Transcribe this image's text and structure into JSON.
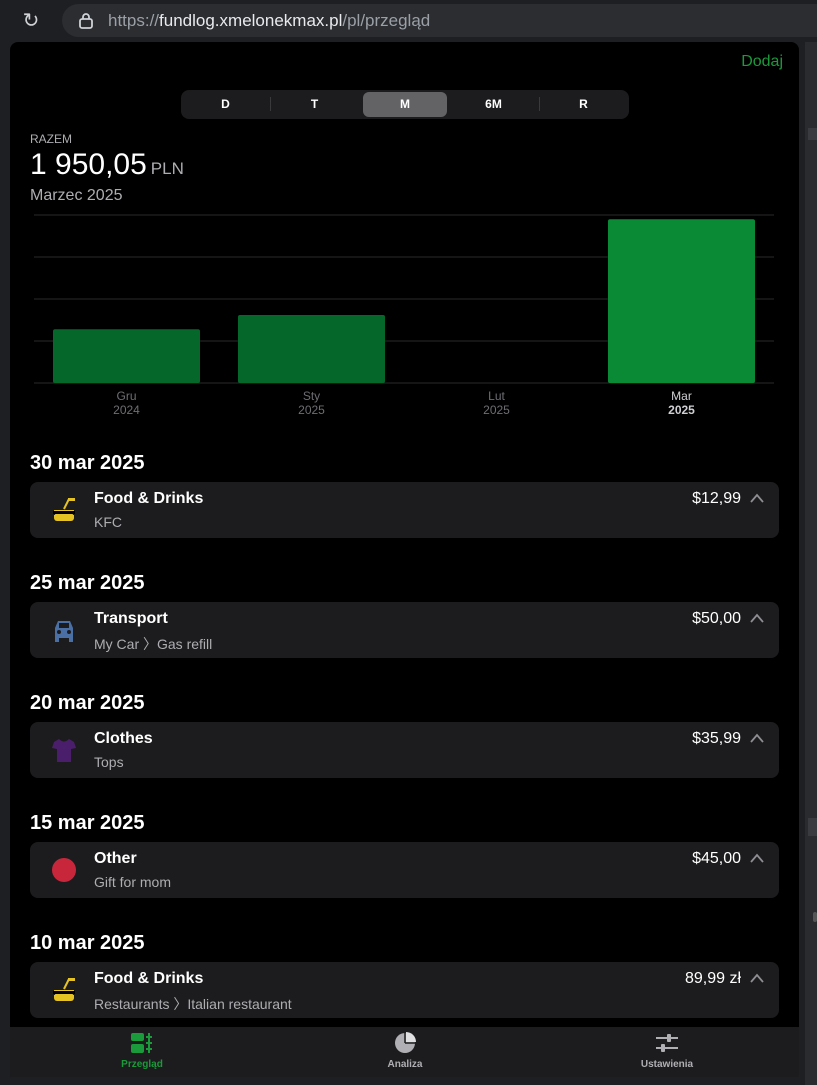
{
  "browser": {
    "url_prefix": "https://",
    "url_host": "fundlog.xmelonekmax.pl",
    "url_path": "/pl/przegląd"
  },
  "header": {
    "add_label": "Dodaj"
  },
  "segments": [
    {
      "label": "D"
    },
    {
      "label": "T"
    },
    {
      "label": "M",
      "active": true
    },
    {
      "label": "6M"
    },
    {
      "label": "R"
    }
  ],
  "summary": {
    "label": "RAZEM",
    "value": "1 950,05",
    "currency": "PLN",
    "period": "Marzec 2025"
  },
  "chart_data": {
    "type": "bar",
    "categories": [
      "Gru 2024",
      "Sty 2025",
      "Lut 2025",
      "Mar 2025"
    ],
    "tick_month": [
      "Gru",
      "Sty",
      "Lut",
      "Mar"
    ],
    "tick_year": [
      "2024",
      "2025",
      "2025",
      "2025"
    ],
    "values": [
      640,
      810,
      0,
      1950.05
    ],
    "selected_index": 3,
    "ylim": [
      0,
      2000
    ],
    "grid": true,
    "colors": {
      "bar": "#05672a",
      "selected": "#0a8a35",
      "grid": "#2a2a2c"
    }
  },
  "transactions": [
    {
      "date": "30 mar 2025",
      "category": "Food & Drinks",
      "sub": "KFC",
      "amount": "$12,99",
      "icon": "food-icon",
      "color": "#e6c323"
    },
    {
      "date": "25 mar 2025",
      "category": "Transport",
      "sub": "My Car 〉Gas refill",
      "amount": "$50,00",
      "icon": "car-icon",
      "color": "#4a6fa5"
    },
    {
      "date": "20 mar 2025",
      "category": "Clothes",
      "sub": "Tops",
      "amount": "$35,99",
      "icon": "shirt-icon",
      "color": "#4b1e6b"
    },
    {
      "date": "15 mar 2025",
      "category": "Other",
      "sub": "Gift for mom",
      "amount": "$45,00",
      "icon": "circle-icon",
      "color": "#c8273b"
    },
    {
      "date": "10 mar 2025",
      "category": "Food & Drinks",
      "sub": "Restaurants 〉Italian restaurant",
      "amount": "89,99 zł",
      "icon": "food-icon",
      "color": "#e6c323"
    }
  ],
  "tabbar": [
    {
      "label": "Przegląd",
      "icon": "overview-icon",
      "active": true
    },
    {
      "label": "Analiza",
      "icon": "pie-chart-icon"
    },
    {
      "label": "Ustawienia",
      "icon": "sliders-icon"
    }
  ],
  "colors": {
    "accent": "#1a9a3a",
    "card": "#1c1c1e",
    "muted": "#aeaeb2"
  }
}
